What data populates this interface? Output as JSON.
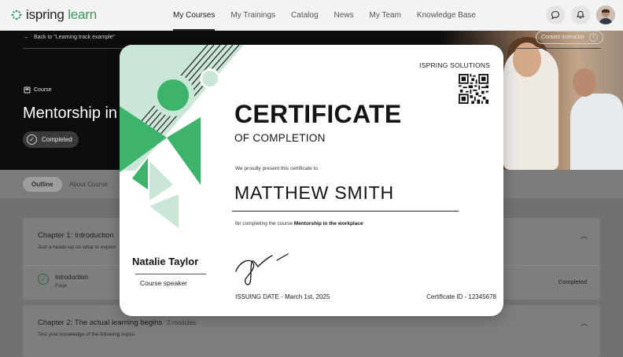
{
  "header": {
    "logo_text": "ispring",
    "logo_accent": "learn",
    "nav": [
      "My Courses",
      "My Trainings",
      "Catalog",
      "News",
      "My Team",
      "Knowledge Base"
    ],
    "active_nav": "My Courses",
    "icons": [
      "chat-icon",
      "bell-icon",
      "user-avatar"
    ]
  },
  "hero": {
    "back_link": "Back to \"Learning track example\"",
    "contact_button": "Contact instructor",
    "contact_help": "?",
    "course_tag": "Course",
    "course_title": "Mentorship in the workplace",
    "status": "Completed"
  },
  "tabs": [
    "Outline",
    "About Course"
  ],
  "chapters": [
    {
      "title": "Chapter 1: Introduction",
      "modules": "",
      "subtitle": "Just a heads-up on what to expect",
      "lessons": [
        {
          "name": "Introduction",
          "type": "Page",
          "status": "Completed"
        }
      ]
    },
    {
      "title": "Chapter 2: The actual learning begins",
      "modules": "2 modules",
      "subtitle": "Test your knowledge of the following topics",
      "lessons": []
    }
  ],
  "certificate": {
    "company": "ISPRING SOLUTIONS",
    "title": "CERTIFICATE",
    "subtitle": "OF COMPLETION",
    "present_text": "We proudly present this certificate to",
    "recipient": "MATTHEW SMITH",
    "completing_text": "for completing the course ",
    "course_name": "Mentorship in the workplace",
    "speaker_name": "Natalie Taylor",
    "speaker_role": "Course speaker",
    "issuing_date": "ISSUING DATE - March 1st, 2025",
    "certificate_id": "Certificate ID - 12345678",
    "accent_color": "#3db36b",
    "light_accent_color": "#c9e6d6"
  },
  "colors": {
    "brand_green": "#3a9b5d",
    "hero_bg": "#0d0d0d"
  }
}
